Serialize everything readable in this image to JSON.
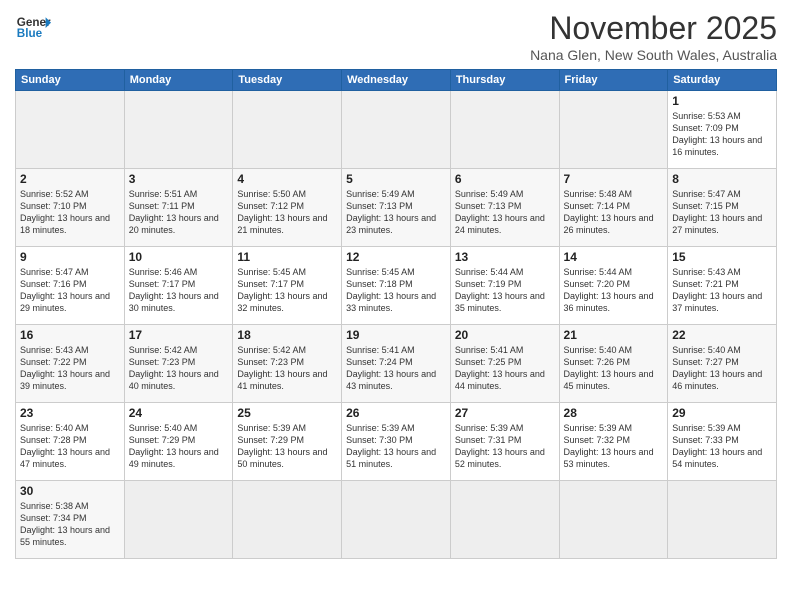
{
  "logo": {
    "text_general": "General",
    "text_blue": "Blue"
  },
  "title": "November 2025",
  "location": "Nana Glen, New South Wales, Australia",
  "weekdays": [
    "Sunday",
    "Monday",
    "Tuesday",
    "Wednesday",
    "Thursday",
    "Friday",
    "Saturday"
  ],
  "weeks": [
    [
      {
        "day": "",
        "empty": true
      },
      {
        "day": "",
        "empty": true
      },
      {
        "day": "",
        "empty": true
      },
      {
        "day": "",
        "empty": true
      },
      {
        "day": "",
        "empty": true
      },
      {
        "day": "",
        "empty": true
      },
      {
        "day": "1",
        "sunrise": "5:53 AM",
        "sunset": "7:09 PM",
        "daylight": "13 hours and 16 minutes."
      }
    ],
    [
      {
        "day": "2",
        "sunrise": "5:52 AM",
        "sunset": "7:10 PM",
        "daylight": "13 hours and 18 minutes."
      },
      {
        "day": "3",
        "sunrise": "5:51 AM",
        "sunset": "7:11 PM",
        "daylight": "13 hours and 20 minutes."
      },
      {
        "day": "4",
        "sunrise": "5:50 AM",
        "sunset": "7:12 PM",
        "daylight": "13 hours and 21 minutes."
      },
      {
        "day": "5",
        "sunrise": "5:49 AM",
        "sunset": "7:13 PM",
        "daylight": "13 hours and 23 minutes."
      },
      {
        "day": "6",
        "sunrise": "5:49 AM",
        "sunset": "7:13 PM",
        "daylight": "13 hours and 24 minutes."
      },
      {
        "day": "7",
        "sunrise": "5:48 AM",
        "sunset": "7:14 PM",
        "daylight": "13 hours and 26 minutes."
      },
      {
        "day": "8",
        "sunrise": "5:47 AM",
        "sunset": "7:15 PM",
        "daylight": "13 hours and 27 minutes."
      }
    ],
    [
      {
        "day": "9",
        "sunrise": "5:47 AM",
        "sunset": "7:16 PM",
        "daylight": "13 hours and 29 minutes."
      },
      {
        "day": "10",
        "sunrise": "5:46 AM",
        "sunset": "7:17 PM",
        "daylight": "13 hours and 30 minutes."
      },
      {
        "day": "11",
        "sunrise": "5:45 AM",
        "sunset": "7:17 PM",
        "daylight": "13 hours and 32 minutes."
      },
      {
        "day": "12",
        "sunrise": "5:45 AM",
        "sunset": "7:18 PM",
        "daylight": "13 hours and 33 minutes."
      },
      {
        "day": "13",
        "sunrise": "5:44 AM",
        "sunset": "7:19 PM",
        "daylight": "13 hours and 35 minutes."
      },
      {
        "day": "14",
        "sunrise": "5:44 AM",
        "sunset": "7:20 PM",
        "daylight": "13 hours and 36 minutes."
      },
      {
        "day": "15",
        "sunrise": "5:43 AM",
        "sunset": "7:21 PM",
        "daylight": "13 hours and 37 minutes."
      }
    ],
    [
      {
        "day": "16",
        "sunrise": "5:43 AM",
        "sunset": "7:22 PM",
        "daylight": "13 hours and 39 minutes."
      },
      {
        "day": "17",
        "sunrise": "5:42 AM",
        "sunset": "7:23 PM",
        "daylight": "13 hours and 40 minutes."
      },
      {
        "day": "18",
        "sunrise": "5:42 AM",
        "sunset": "7:23 PM",
        "daylight": "13 hours and 41 minutes."
      },
      {
        "day": "19",
        "sunrise": "5:41 AM",
        "sunset": "7:24 PM",
        "daylight": "13 hours and 43 minutes."
      },
      {
        "day": "20",
        "sunrise": "5:41 AM",
        "sunset": "7:25 PM",
        "daylight": "13 hours and 44 minutes."
      },
      {
        "day": "21",
        "sunrise": "5:40 AM",
        "sunset": "7:26 PM",
        "daylight": "13 hours and 45 minutes."
      },
      {
        "day": "22",
        "sunrise": "5:40 AM",
        "sunset": "7:27 PM",
        "daylight": "13 hours and 46 minutes."
      }
    ],
    [
      {
        "day": "23",
        "sunrise": "5:40 AM",
        "sunset": "7:28 PM",
        "daylight": "13 hours and 47 minutes."
      },
      {
        "day": "24",
        "sunrise": "5:40 AM",
        "sunset": "7:29 PM",
        "daylight": "13 hours and 49 minutes."
      },
      {
        "day": "25",
        "sunrise": "5:39 AM",
        "sunset": "7:29 PM",
        "daylight": "13 hours and 50 minutes."
      },
      {
        "day": "26",
        "sunrise": "5:39 AM",
        "sunset": "7:30 PM",
        "daylight": "13 hours and 51 minutes."
      },
      {
        "day": "27",
        "sunrise": "5:39 AM",
        "sunset": "7:31 PM",
        "daylight": "13 hours and 52 minutes."
      },
      {
        "day": "28",
        "sunrise": "5:39 AM",
        "sunset": "7:32 PM",
        "daylight": "13 hours and 53 minutes."
      },
      {
        "day": "29",
        "sunrise": "5:39 AM",
        "sunset": "7:33 PM",
        "daylight": "13 hours and 54 minutes."
      }
    ],
    [
      {
        "day": "30",
        "sunrise": "5:38 AM",
        "sunset": "7:34 PM",
        "daylight": "13 hours and 55 minutes."
      },
      {
        "day": "",
        "empty": true
      },
      {
        "day": "",
        "empty": true
      },
      {
        "day": "",
        "empty": true
      },
      {
        "day": "",
        "empty": true
      },
      {
        "day": "",
        "empty": true
      },
      {
        "day": "",
        "empty": true
      }
    ]
  ],
  "labels": {
    "sunrise": "Sunrise:",
    "sunset": "Sunset:",
    "daylight": "Daylight:"
  }
}
